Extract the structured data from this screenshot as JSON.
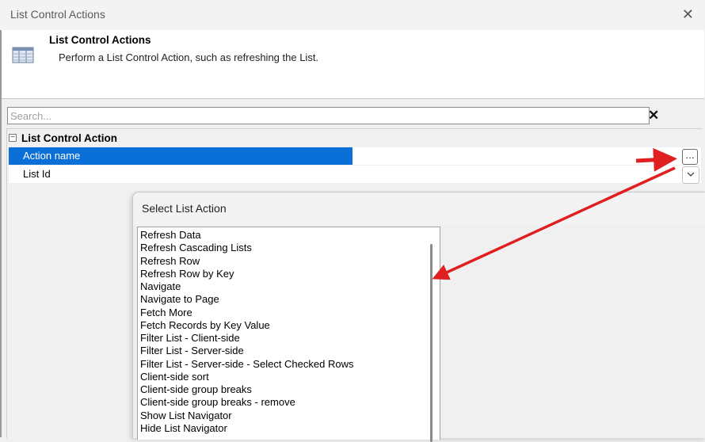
{
  "window": {
    "title": "List Control Actions",
    "close_glyph": "✕"
  },
  "header": {
    "title": "List Control Actions",
    "description": "Perform a List Control Action, such as refreshing the List.",
    "icon": "list-table-icon"
  },
  "search": {
    "placeholder": "Search...",
    "value": "",
    "clear_glyph": "✕"
  },
  "property_grid": {
    "category": {
      "toggle_glyph": "−",
      "label": "List Control Action"
    },
    "rows": [
      {
        "name": "Action name",
        "value": "",
        "selected": true,
        "button": "…"
      },
      {
        "name": "List Id",
        "value": "",
        "selected": false,
        "button": "chevron-down-icon"
      }
    ]
  },
  "popup": {
    "title": "Select List Action",
    "items": [
      "Refresh Data",
      "Refresh Cascading Lists",
      "Refresh Row",
      "Refresh Row by Key",
      "Navigate",
      "Navigate to Page",
      "Fetch More",
      "Fetch Records by Key Value",
      "Filter List - Client-side",
      "Filter List - Server-side",
      "Filter List - Server-side - Select Checked Rows",
      "Client-side sort",
      "Client-side group breaks",
      "Client-side group breaks - remove",
      "Show List Navigator",
      "Hide List Navigator"
    ]
  },
  "colors": {
    "selection": "#0a6fd6",
    "annotation_arrow": "#e02020"
  }
}
